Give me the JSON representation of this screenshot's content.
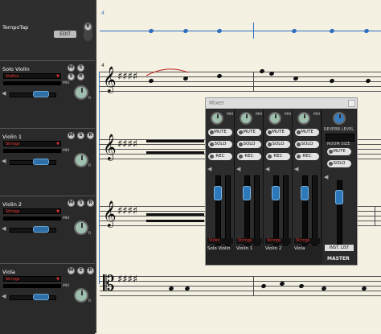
{
  "tempo": {
    "label": "TempoTap",
    "edit_label": "EDIT",
    "r_label": "R"
  },
  "tracks": [
    {
      "name": "Solo Violin",
      "instrument": "Violins",
      "m": "M",
      "s": "S",
      "r": "R",
      "mix_label": "MIX",
      "pan_label": "R"
    },
    {
      "name": "Violin 1",
      "instrument": "Strings",
      "m": "M",
      "s": "S",
      "r": "R",
      "mix_label": "MIX",
      "pan_label": "R"
    },
    {
      "name": "Violin 2",
      "instrument": "Strings",
      "m": "M",
      "s": "S",
      "r": "R",
      "mix_label": "MIX",
      "pan_label": "R"
    },
    {
      "name": "Viola",
      "instrument": "Strings",
      "m": "M",
      "s": "S",
      "r": "R",
      "mix_label": "MIX",
      "pan_label": "R"
    }
  ],
  "score": {
    "measure_top": "4",
    "measure_second": "4"
  },
  "mixer": {
    "title": "Mixer",
    "mix_label": "MIX",
    "mute_label": "MUTE",
    "solo_label": "SOLO",
    "rec_label": "REC",
    "channels": [
      {
        "name": "Solo Violin",
        "instrument": "Violin"
      },
      {
        "name": "Violin 1",
        "instrument": "Strings"
      },
      {
        "name": "Violin 2",
        "instrument": "Strings"
      },
      {
        "name": "Viola",
        "instrument": "Strings"
      }
    ],
    "reverb_label": "REVERB LEVEL",
    "room_size_label": "ROOM SIZE",
    "inst_list_label": "INST. LIST",
    "master_label": "MASTER"
  },
  "colors": {
    "accent_blue": "#2d6fa6",
    "instrument_red": "#e33",
    "knob_green": "#9fbfae"
  }
}
